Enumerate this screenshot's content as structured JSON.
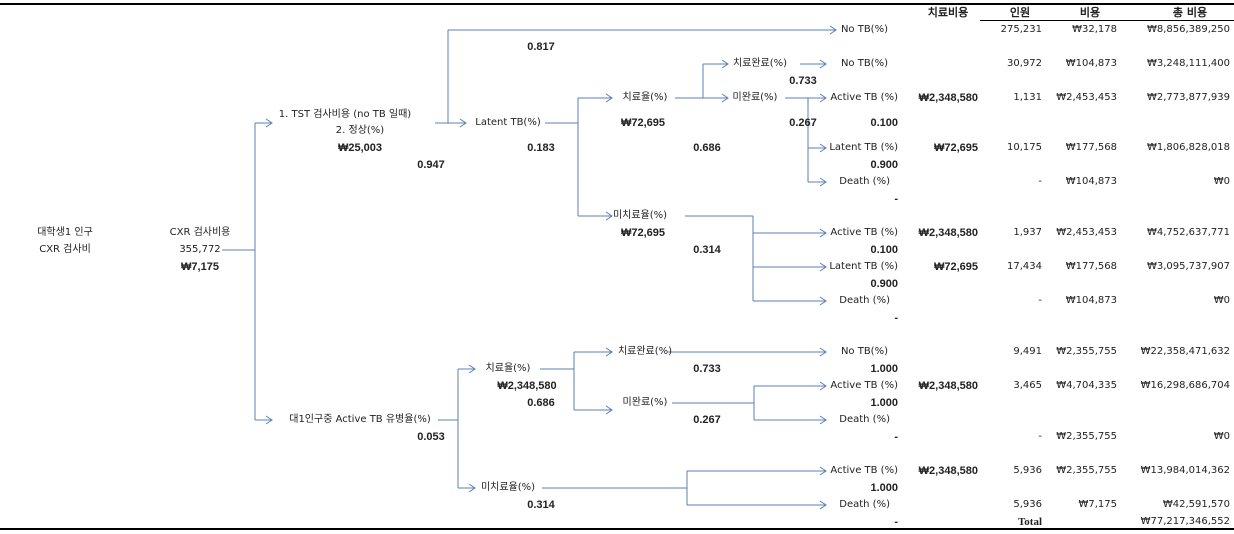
{
  "header": {
    "treatment_cost": "치료비용",
    "persons": "인원",
    "cost": "비용",
    "total_cost": "총 비용"
  },
  "tree": {
    "root": {
      "line1": "대학생1 인구",
      "line2": "CXR 검사비"
    },
    "cxr": {
      "label": "CXR 검사비용",
      "count": "355,772",
      "cost": "₩7,175"
    },
    "tst": {
      "line1": "1. TST 검사비용 (no TB 일때)",
      "line2": "2. 정상(%)",
      "cost": "₩25,003",
      "prob": "0.947"
    },
    "no_tb_top": {
      "prob": "0.817",
      "outcome": "No TB(%)"
    },
    "latent": {
      "label": "Latent TB(%)",
      "prob": "0.183"
    },
    "latent_treat": {
      "label": "치료율(%)",
      "cost": "₩72,695",
      "prob": "0.686"
    },
    "latent_treat_complete": {
      "label": "치료완료(%)",
      "prob": "0.733",
      "outcome": "No TB(%)"
    },
    "latent_treat_incomplete": {
      "label": "미완료(%)",
      "prob": "0.267",
      "outcomes": [
        {
          "label": "Active TB (%)",
          "prob": "0.100"
        },
        {
          "label": "Latent TB (%)",
          "prob": "0.900"
        },
        {
          "label": "Death (%)",
          "prob": "-"
        }
      ]
    },
    "latent_untreated": {
      "label": "미치료율(%)",
      "cost": "₩72,695",
      "prob": "0.314",
      "outcomes": [
        {
          "label": "Active TB (%)",
          "prob": "0.100"
        },
        {
          "label": "Latent TB (%)",
          "prob": "0.900"
        },
        {
          "label": "Death (%)",
          "prob": "-"
        }
      ]
    },
    "active": {
      "label": "대1인구중 Active TB 유병율(%)",
      "prob": "0.053"
    },
    "active_treat": {
      "label": "치료율(%)",
      "cost": "₩2,348,580",
      "prob": "0.686"
    },
    "active_treat_complete": {
      "label": "치료완료(%)",
      "prob": "0.733",
      "outcome": "No TB(%)",
      "outcome_prob": "1.000"
    },
    "active_treat_incomplete": {
      "label": "미완료(%)",
      "prob": "0.267",
      "outcomes": [
        {
          "label": "Active TB (%)",
          "prob": "1.000"
        },
        {
          "label": "Death (%)",
          "prob": "-"
        }
      ]
    },
    "active_untreated": {
      "label": "미치료율(%)",
      "prob": "0.314",
      "outcomes": [
        {
          "label": "Active TB (%)",
          "prob": "1.000"
        },
        {
          "label": "Death (%)",
          "prob": "-"
        }
      ]
    }
  },
  "table": {
    "rows": [
      {
        "treatment_cost": "",
        "persons": "275,231",
        "cost": "₩32,178",
        "total": "₩8,856,389,250"
      },
      {
        "treatment_cost": "",
        "persons": "30,972",
        "cost": "₩104,873",
        "total": "₩3,248,111,400"
      },
      {
        "treatment_cost": "₩2,348,580",
        "persons": "1,131",
        "cost": "₩2,453,453",
        "total": "₩2,773,877,939"
      },
      {
        "treatment_cost": "₩72,695",
        "persons": "10,175",
        "cost": "₩177,568",
        "total": "₩1,806,828,018"
      },
      {
        "treatment_cost": "",
        "persons": "-",
        "cost": "₩104,873",
        "total": "₩0"
      },
      {
        "treatment_cost": "₩2,348,580",
        "persons": "1,937",
        "cost": "₩2,453,453",
        "total": "₩4,752,637,771"
      },
      {
        "treatment_cost": "₩72,695",
        "persons": "17,434",
        "cost": "₩177,568",
        "total": "₩3,095,737,907"
      },
      {
        "treatment_cost": "",
        "persons": "-",
        "cost": "₩104,873",
        "total": "₩0"
      },
      {
        "treatment_cost": "",
        "persons": "9,491",
        "cost": "₩2,355,755",
        "total": "₩22,358,471,632"
      },
      {
        "treatment_cost": "₩2,348,580",
        "persons": "3,465",
        "cost": "₩4,704,335",
        "total": "₩16,298,686,704"
      },
      {
        "treatment_cost": "",
        "persons": "-",
        "cost": "₩2,355,755",
        "total": "₩0"
      },
      {
        "treatment_cost": "₩2,348,580",
        "persons": "5,936",
        "cost": "₩2,355,755",
        "total": "₩13,984,014,362"
      },
      {
        "treatment_cost": "",
        "persons": "5,936",
        "cost": "₩7,175",
        "total": "₩42,591,570"
      }
    ],
    "total_label": "Total",
    "total_value": "₩77,217,346,552"
  },
  "colors": {
    "connector": "#5b7fb3"
  }
}
